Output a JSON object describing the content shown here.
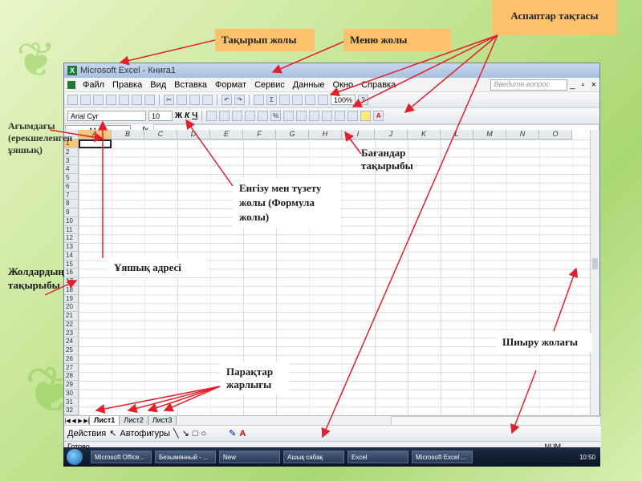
{
  "callouts": {
    "title_bar": "Тақырып жолы",
    "menu_bar": "Меню жолы",
    "toolbar": "Аспаптар тақтасы",
    "active_cell": "Ағымдағы (ерекшеленген ұяшық)",
    "column_headers": "Бағандар тақырыбы",
    "formula_bar": "Енгізу мен түзету жолы (Формула жолы)",
    "cell_address": "Ұяшық адресі",
    "row_headers": "Жолдардың тақырыбы",
    "sheet_tabs": "Парақтар жарлығы",
    "scroll_bar": "Шиыру жолағы"
  },
  "window": {
    "title": "Microsoft Excel - Книга1",
    "menu": [
      "Файл",
      "Правка",
      "Вид",
      "Вставка",
      "Формат",
      "Сервис",
      "Данные",
      "Окно",
      "Справка"
    ],
    "help_placeholder": "Введите вопрос",
    "zoom": "100%",
    "font_name": "Arial Cyr",
    "font_size": "10",
    "name_box": "A1",
    "fx": "fx",
    "columns": [
      "A",
      "B",
      "C",
      "D",
      "E",
      "F",
      "G",
      "H",
      "I",
      "J",
      "K",
      "L",
      "M",
      "N",
      "O"
    ],
    "rows": [
      "1",
      "2",
      "3",
      "4",
      "5",
      "6",
      "7",
      "8",
      "9",
      "10",
      "11",
      "12",
      "13",
      "14",
      "15",
      "16",
      "17",
      "18",
      "19",
      "20",
      "21",
      "22",
      "23",
      "24",
      "25",
      "26",
      "27",
      "28",
      "29",
      "30",
      "31",
      "32"
    ],
    "sheets": [
      "Лист1",
      "Лист2",
      "Лист3"
    ],
    "draw_actions": "Действия",
    "autoshapes": "Автофигуры",
    "status": "Готово",
    "num": "NUM"
  },
  "taskbar": {
    "tasks": [
      "Microsoft Office...",
      "Безымянный - ...",
      "New",
      "Ашық сабақ",
      "Excel",
      "Microsoft Excel ..."
    ],
    "clock": "10:50"
  },
  "colors": {
    "callout_bg": "#fcc16b",
    "arrow": "#e0202a",
    "selected_header": "#f5c77a"
  }
}
